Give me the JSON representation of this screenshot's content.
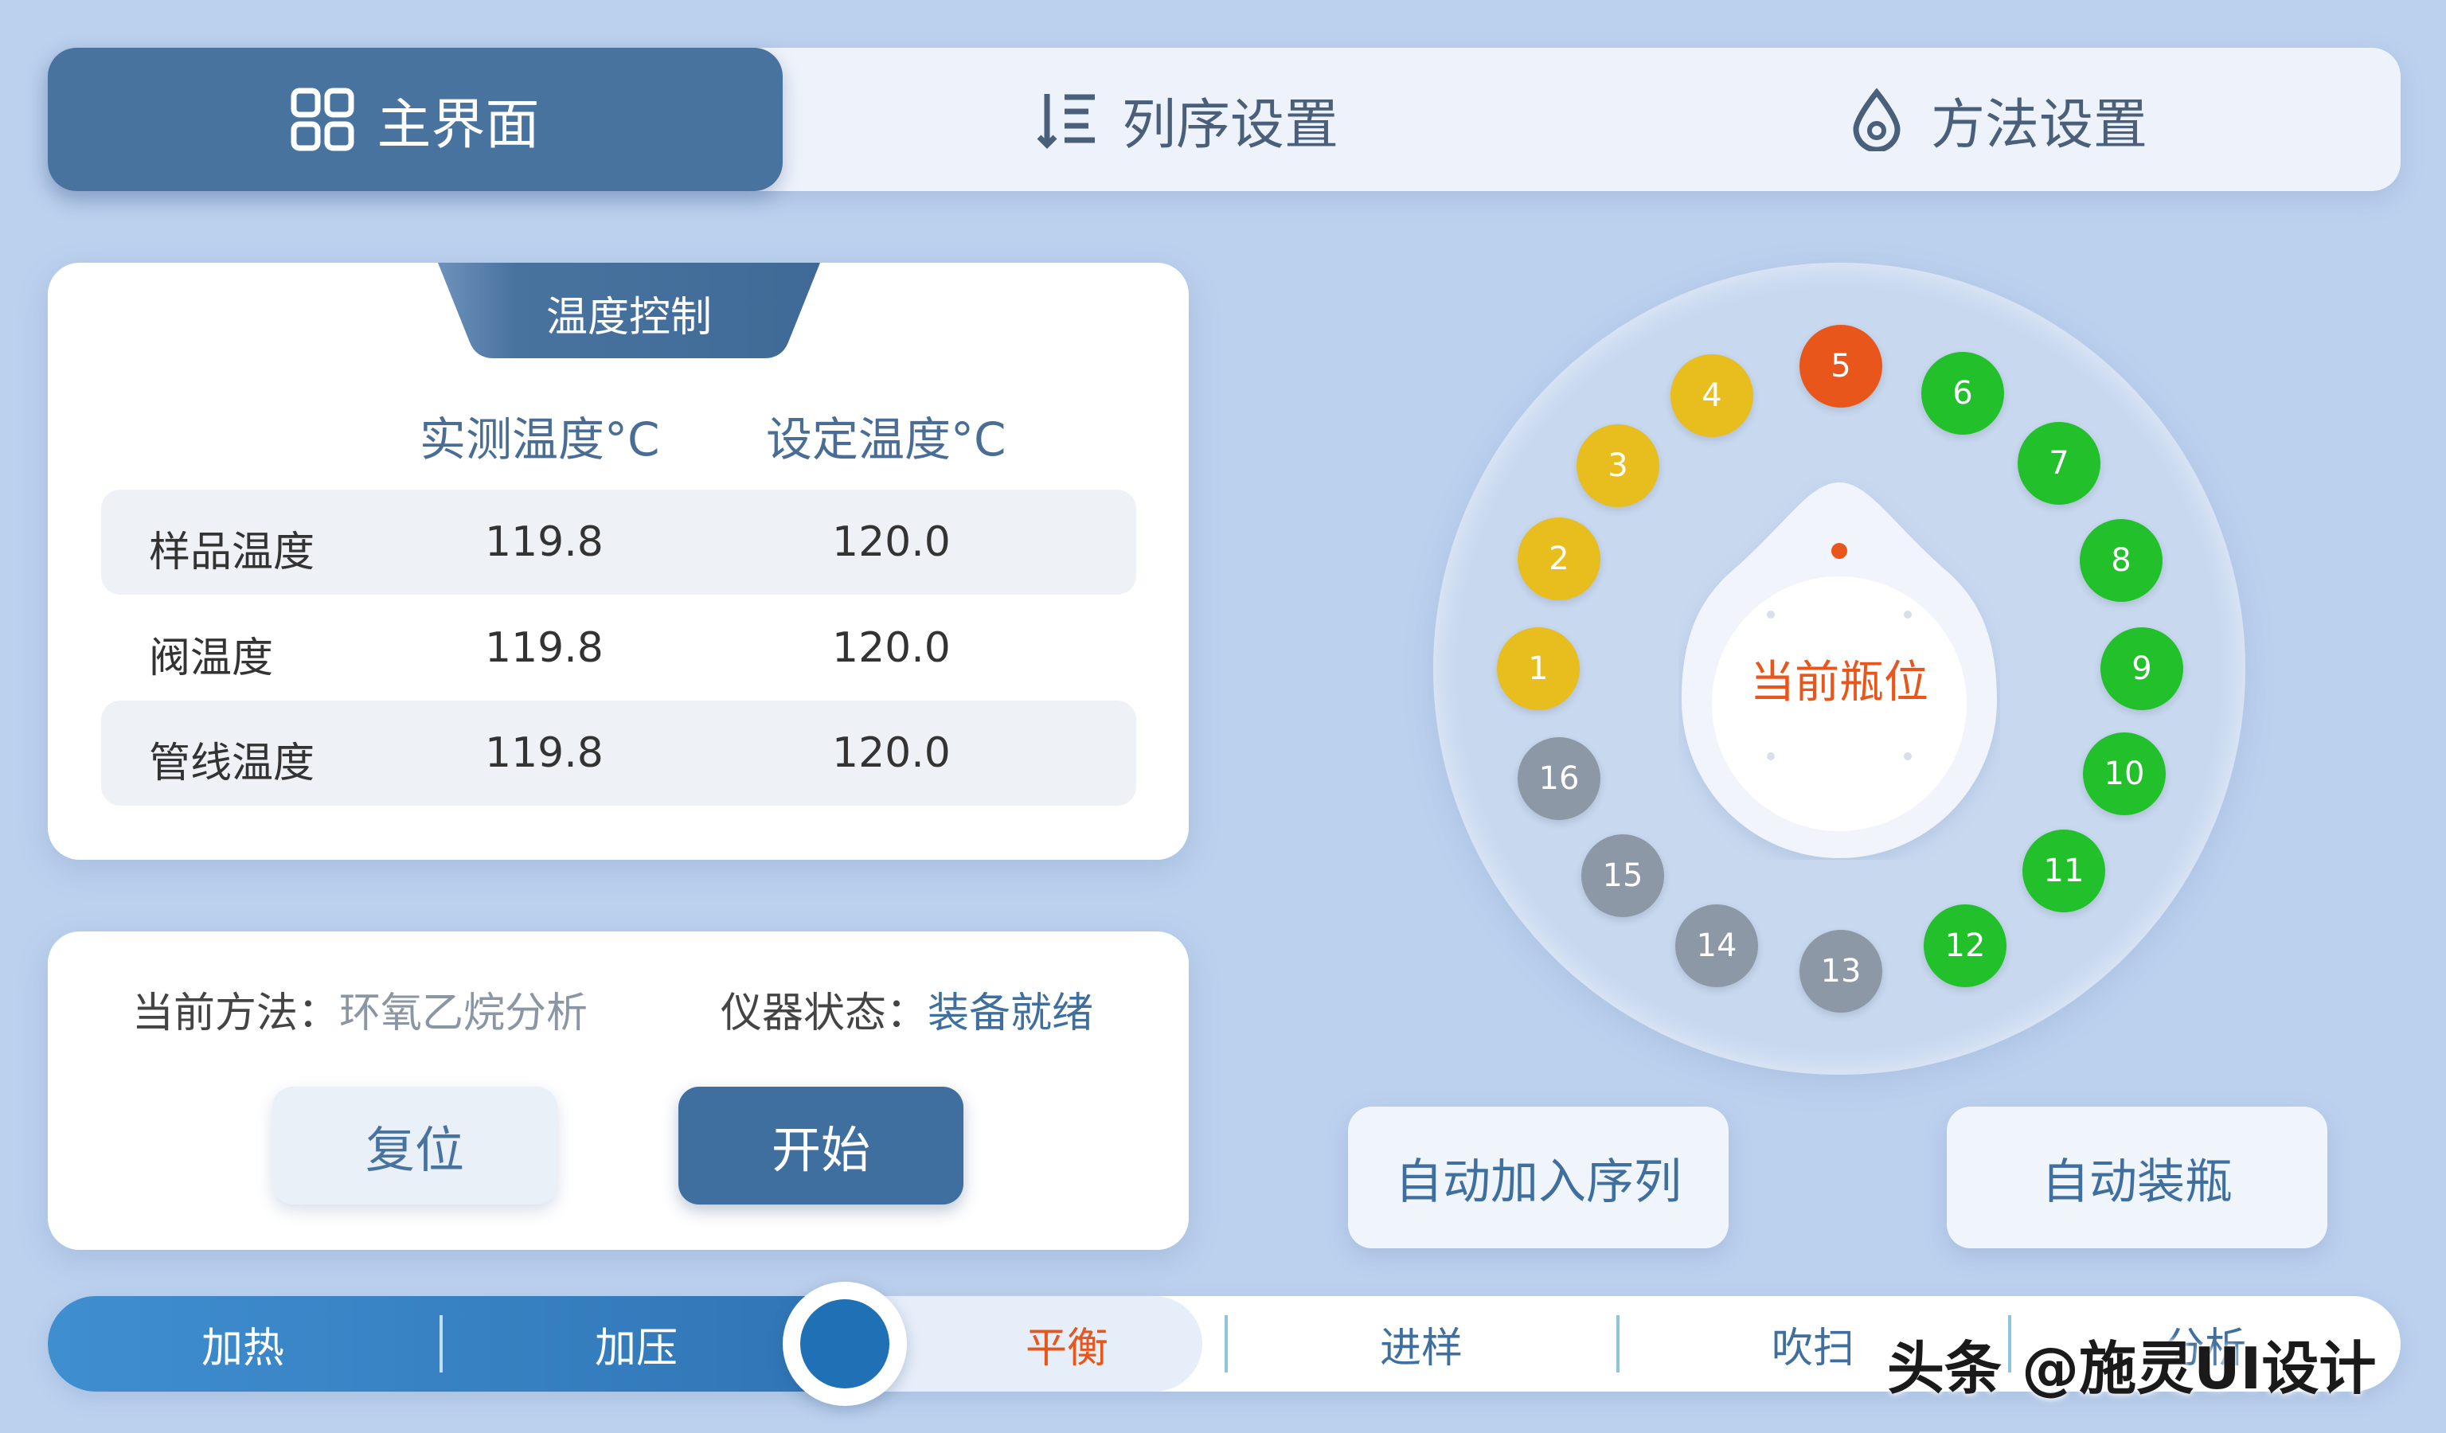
{
  "nav": {
    "tabs": [
      {
        "label": "主界面",
        "icon": "grid-icon",
        "active": true
      },
      {
        "label": "列序设置",
        "icon": "sort-list-icon",
        "active": false
      },
      {
        "label": "方法设置",
        "icon": "drop-icon",
        "active": false
      }
    ]
  },
  "temperature": {
    "tab_label": "温度控制",
    "headers": [
      "实测温度°C",
      "设定温度°C"
    ],
    "rows": [
      {
        "name": "样品温度",
        "measured": "119.8",
        "setpoint": "120.0"
      },
      {
        "name": "阀温度",
        "measured": "119.8",
        "setpoint": "120.0"
      },
      {
        "name": "管线温度",
        "measured": "119.8",
        "setpoint": "120.0"
      }
    ]
  },
  "method": {
    "current_label": "当前方法：",
    "current_value": "环氧乙烷分析",
    "status_label": "仪器状态：",
    "status_value": "装备就绪",
    "reset_label": "复位",
    "start_label": "开始"
  },
  "carousel": {
    "center_label": "当前瓶位",
    "vials": [
      {
        "n": "1",
        "state": "yellow"
      },
      {
        "n": "2",
        "state": "yellow"
      },
      {
        "n": "3",
        "state": "yellow"
      },
      {
        "n": "4",
        "state": "yellow"
      },
      {
        "n": "5",
        "state": "current"
      },
      {
        "n": "6",
        "state": "green"
      },
      {
        "n": "7",
        "state": "green"
      },
      {
        "n": "8",
        "state": "green"
      },
      {
        "n": "9",
        "state": "green"
      },
      {
        "n": "10",
        "state": "green"
      },
      {
        "n": "11",
        "state": "green"
      },
      {
        "n": "12",
        "state": "green"
      },
      {
        "n": "13",
        "state": "gray"
      },
      {
        "n": "14",
        "state": "gray"
      },
      {
        "n": "15",
        "state": "gray"
      },
      {
        "n": "16",
        "state": "gray"
      }
    ]
  },
  "actions": {
    "auto_queue": "自动加入序列",
    "auto_bottle": "自动装瓶"
  },
  "process": {
    "steps": [
      "加热",
      "加压",
      "平衡",
      "进样",
      "吹扫",
      "分析"
    ]
  },
  "watermark": "头条 @施灵UI设计",
  "colors": {
    "primary": "#49739f",
    "current_vial": "#e8561c",
    "yellow_vial": "#e8bd1e",
    "green_vial": "#22c02a",
    "gray_vial": "#8d98a6"
  }
}
